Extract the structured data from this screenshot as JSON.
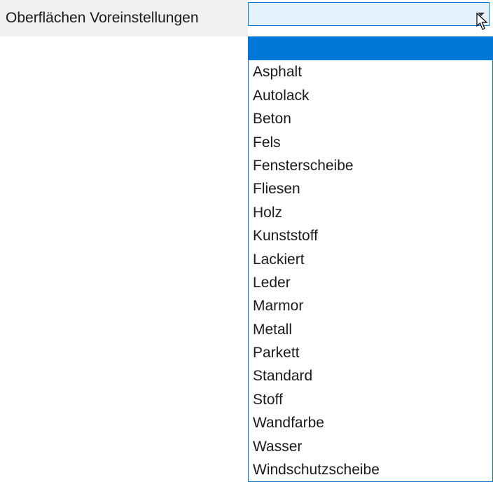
{
  "field": {
    "label": "Oberflächen Voreinstellungen"
  },
  "dropdown": {
    "selected_index": 0,
    "options": [
      "",
      "Asphalt",
      "Autolack",
      "Beton",
      "Fels",
      "Fensterscheibe",
      "Fliesen",
      "Holz",
      "Kunststoff",
      "Lackiert",
      "Leder",
      "Marmor",
      "Metall",
      "Parkett",
      "Standard",
      "Stoff",
      "Wandfarbe",
      "Wasser",
      "Windschutzscheibe"
    ]
  }
}
